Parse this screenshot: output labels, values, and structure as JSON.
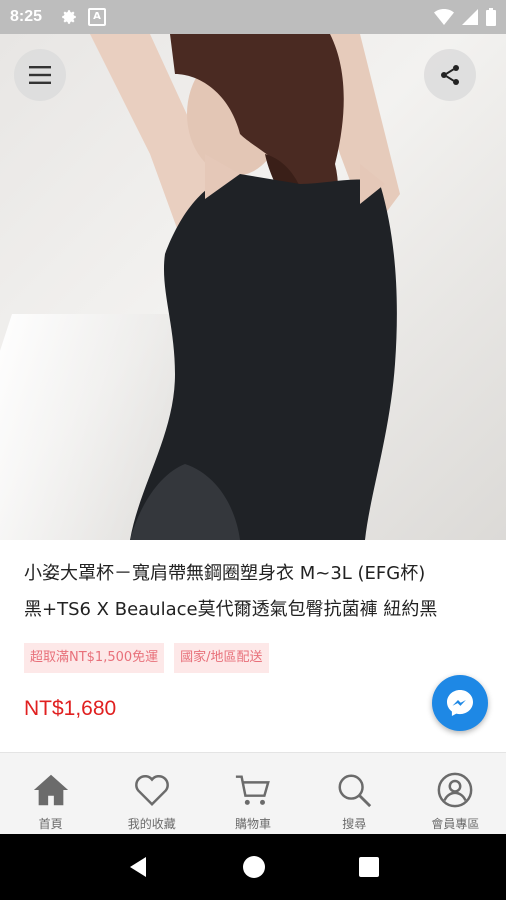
{
  "status_bar": {
    "time": "8:25",
    "icons": [
      "gear-icon",
      "a-notification-icon",
      "wifi-icon",
      "signal-icon",
      "battery-icon"
    ]
  },
  "hero": {
    "menu_icon": "hamburger-menu-icon",
    "share_icon": "share-icon"
  },
  "product": {
    "title_line1": "小姿大罩杯－寬肩帶無鋼圈塑身衣 M~3L (EFG杯)",
    "title_line2": "黑+TS6 X Beaulace莫代爾透氣包臀抗菌褲 紐約黑",
    "tags": [
      "超取滿NT$1,500免運",
      "國家/地區配送"
    ],
    "price": "NT$1,680"
  },
  "messenger": {
    "icon": "messenger-icon",
    "color": "#1e88e5"
  },
  "bottom_nav": {
    "items": [
      {
        "label": "首頁",
        "icon": "home-icon"
      },
      {
        "label": "我的收藏",
        "icon": "heart-icon"
      },
      {
        "label": "購物車",
        "icon": "cart-icon"
      },
      {
        "label": "搜尋",
        "icon": "search-icon"
      },
      {
        "label": "會員專區",
        "icon": "member-icon"
      }
    ]
  },
  "android_nav": {
    "icons": [
      "back-icon",
      "home-circle-icon",
      "recents-icon"
    ]
  },
  "colors": {
    "price": "#e02020",
    "tag_bg": "#fde8e8",
    "tag_text": "#e8707a"
  }
}
